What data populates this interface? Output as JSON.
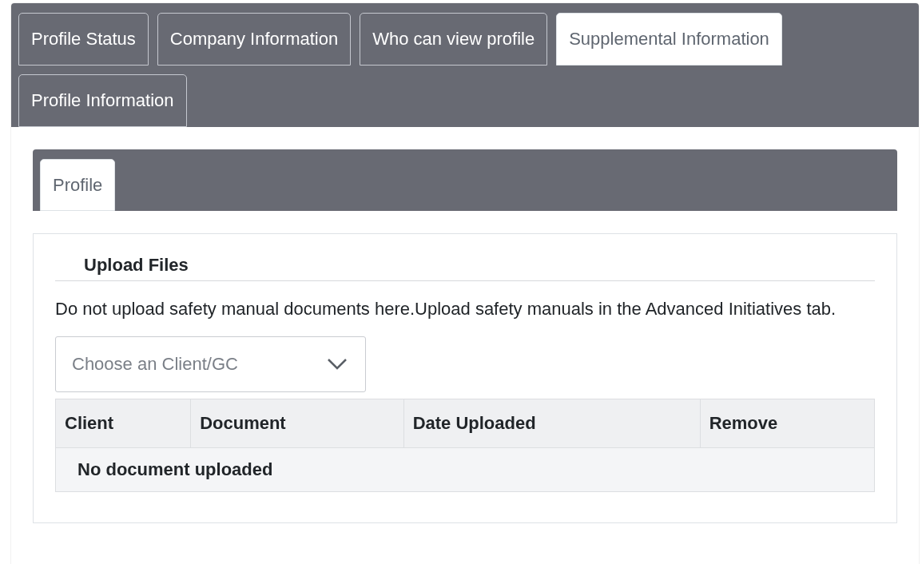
{
  "main_tabs": [
    {
      "label": "Profile Status",
      "selected": false
    },
    {
      "label": "Company Information",
      "selected": false
    },
    {
      "label": "Who can view profile",
      "selected": false
    },
    {
      "label": "Supplemental Information",
      "selected": true
    },
    {
      "label": "Profile Information",
      "selected": false
    }
  ],
  "sub_tabs": [
    {
      "label": "Profile",
      "selected": true
    }
  ],
  "section": {
    "title": "Upload Files",
    "notice": "Do not upload safety manual documents here.Upload safety manuals in the Advanced Initiatives tab.",
    "select": {
      "placeholder": "Choose an Client/GC"
    }
  },
  "table": {
    "columns": [
      "Client",
      "Document",
      "Date Uploaded",
      "Remove"
    ],
    "empty_message": "No document uploaded"
  }
}
